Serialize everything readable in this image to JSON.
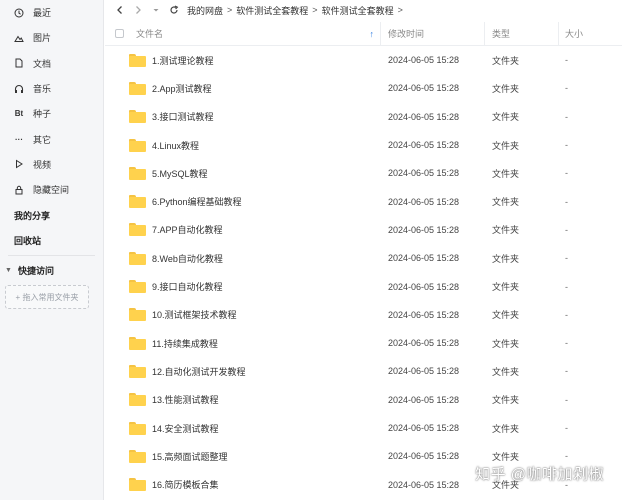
{
  "sidebar": {
    "items": [
      {
        "label": "最近",
        "icon": "clock-icon"
      },
      {
        "label": "图片",
        "icon": "mountain-icon"
      },
      {
        "label": "文档",
        "icon": "document-icon"
      },
      {
        "label": "音乐",
        "icon": "headphones-icon"
      },
      {
        "label": "种子",
        "icon": "bt-icon",
        "glyph": "Bt"
      },
      {
        "label": "其它",
        "icon": "more-icon",
        "glyph": "···"
      },
      {
        "label": "视频",
        "icon": "play-icon"
      },
      {
        "label": "隐藏空间",
        "icon": "lock-icon"
      }
    ],
    "my_share": "我的分享",
    "recycle": "回收站",
    "quick_access": "快捷访问",
    "drop_hint": "+ 拖入常用文件夹"
  },
  "toolbar": {
    "breadcrumb": [
      "我的网盘",
      "软件测试全套教程",
      "软件测试全套教程"
    ],
    "sep": ">"
  },
  "table": {
    "headers": {
      "name": "文件名",
      "time": "修改时间",
      "type": "类型",
      "size": "大小"
    },
    "rows": [
      {
        "name": "1.测试理论教程",
        "time": "2024-06-05 15:28",
        "type": "文件夹",
        "size": "-"
      },
      {
        "name": "2.App测试教程",
        "time": "2024-06-05 15:28",
        "type": "文件夹",
        "size": "-"
      },
      {
        "name": "3.接口测试教程",
        "time": "2024-06-05 15:28",
        "type": "文件夹",
        "size": "-"
      },
      {
        "name": "4.Linux教程",
        "time": "2024-06-05 15:28",
        "type": "文件夹",
        "size": "-"
      },
      {
        "name": "5.MySQL教程",
        "time": "2024-06-05 15:28",
        "type": "文件夹",
        "size": "-"
      },
      {
        "name": "6.Python编程基础教程",
        "time": "2024-06-05 15:28",
        "type": "文件夹",
        "size": "-"
      },
      {
        "name": "7.APP自动化教程",
        "time": "2024-06-05 15:28",
        "type": "文件夹",
        "size": "-"
      },
      {
        "name": "8.Web自动化教程",
        "time": "2024-06-05 15:28",
        "type": "文件夹",
        "size": "-"
      },
      {
        "name": "9.接口自动化教程",
        "time": "2024-06-05 15:28",
        "type": "文件夹",
        "size": "-"
      },
      {
        "name": "10.测试框架技术教程",
        "time": "2024-06-05 15:28",
        "type": "文件夹",
        "size": "-"
      },
      {
        "name": "11.持续集成教程",
        "time": "2024-06-05 15:28",
        "type": "文件夹",
        "size": "-"
      },
      {
        "name": "12.自动化测试开发教程",
        "time": "2024-06-05 15:28",
        "type": "文件夹",
        "size": "-"
      },
      {
        "name": "13.性能测试教程",
        "time": "2024-06-05 15:28",
        "type": "文件夹",
        "size": "-"
      },
      {
        "name": "14.安全测试教程",
        "time": "2024-06-05 15:28",
        "type": "文件夹",
        "size": "-"
      },
      {
        "name": "15.高频面试题整理",
        "time": "2024-06-05 15:28",
        "type": "文件夹",
        "size": "-"
      },
      {
        "name": "16.简历模板合集",
        "time": "2024-06-05 15:28",
        "type": "文件夹",
        "size": "-"
      }
    ]
  },
  "watermark": "知乎 @咖啡加剁椒",
  "colors": {
    "accent": "#2a7ae2",
    "folder": "#ffd24d",
    "sidebar_bg": "#f5f6f8"
  }
}
